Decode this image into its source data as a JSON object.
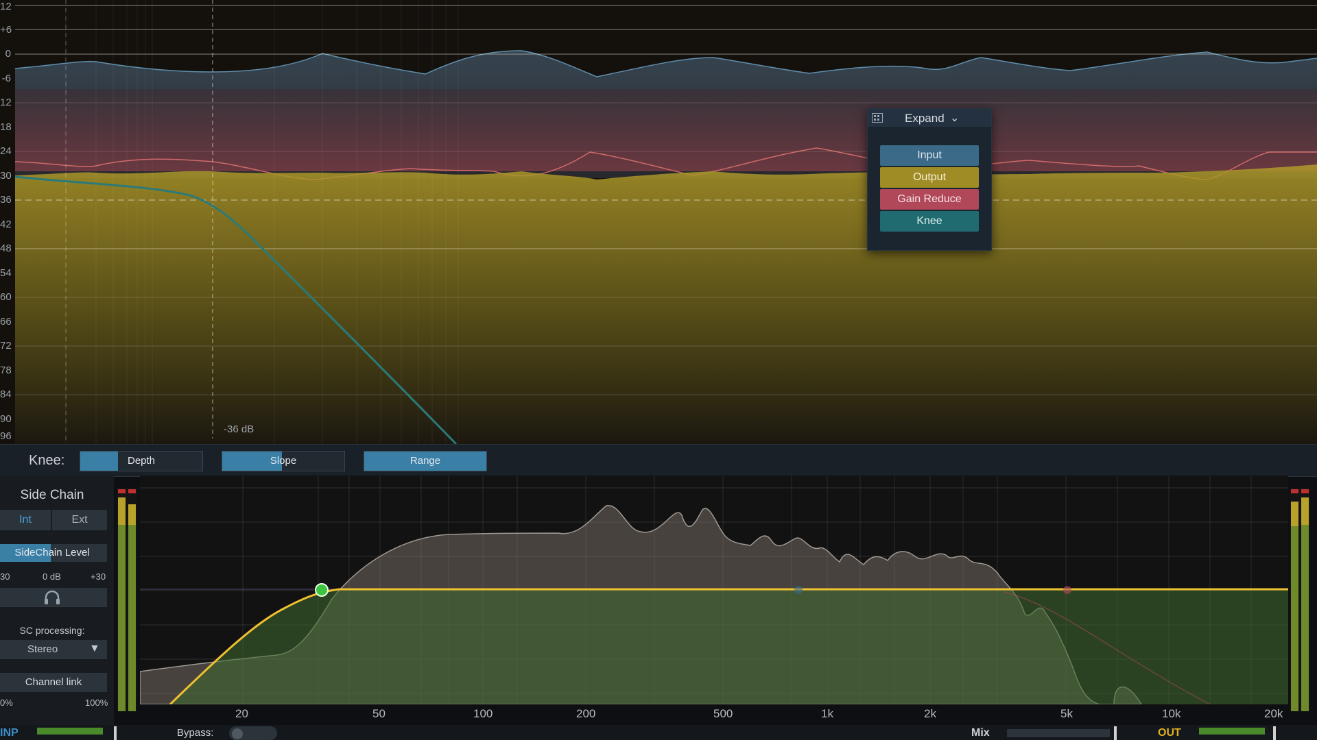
{
  "top_graph": {
    "y_axis_labels": [
      "12",
      "+6",
      "0",
      "-6",
      "12",
      "18",
      "24",
      "30",
      "36",
      "42",
      "48",
      "54",
      "60",
      "66",
      "72",
      "78",
      "84",
      "90",
      "96"
    ],
    "cursor_readout": "-36 dB",
    "threshold_db": -36
  },
  "popup": {
    "title": "Expand",
    "items": [
      {
        "label": "Input",
        "color": "#3b6a88"
      },
      {
        "label": "Output",
        "color": "#a08c24"
      },
      {
        "label": "Gain Reduce",
        "color": "#b0485a"
      },
      {
        "label": "Knee",
        "color": "#1f6b70"
      }
    ]
  },
  "knee": {
    "label": "Knee:",
    "controls": [
      {
        "label": "Depth",
        "fill": 0.31
      },
      {
        "label": "Slope",
        "fill": 0.49
      },
      {
        "label": "Range",
        "fill": 1.0
      }
    ]
  },
  "side_chain": {
    "title": "Side Chain",
    "int_label": "Int",
    "ext_label": "Ext",
    "level_label": "SideChain Level",
    "level_min": "30",
    "level_mid": "0 dB",
    "level_max": "+30",
    "sc_processing_label": "SC processing:",
    "sc_processing_value": "Stereo",
    "channel_link_label": "Channel link",
    "link_min": "0%",
    "link_max": "100%"
  },
  "eq_graph": {
    "x_labels": [
      "20",
      "50",
      "100",
      "200",
      "500",
      "1k",
      "2k",
      "5k",
      "10k",
      "20k"
    ]
  },
  "bottom_bar": {
    "inp_label": "INP",
    "bypass_label": "Bypass:",
    "mix_label": "Mix",
    "out_label": "OUT"
  },
  "colors": {
    "input": "#5f8fae",
    "output": "#a8922a",
    "gain_reduce": "#c9606c",
    "knee": "#2a7a7a",
    "eq_curve": "#f0c030",
    "eq_node": "#3ec43e"
  }
}
